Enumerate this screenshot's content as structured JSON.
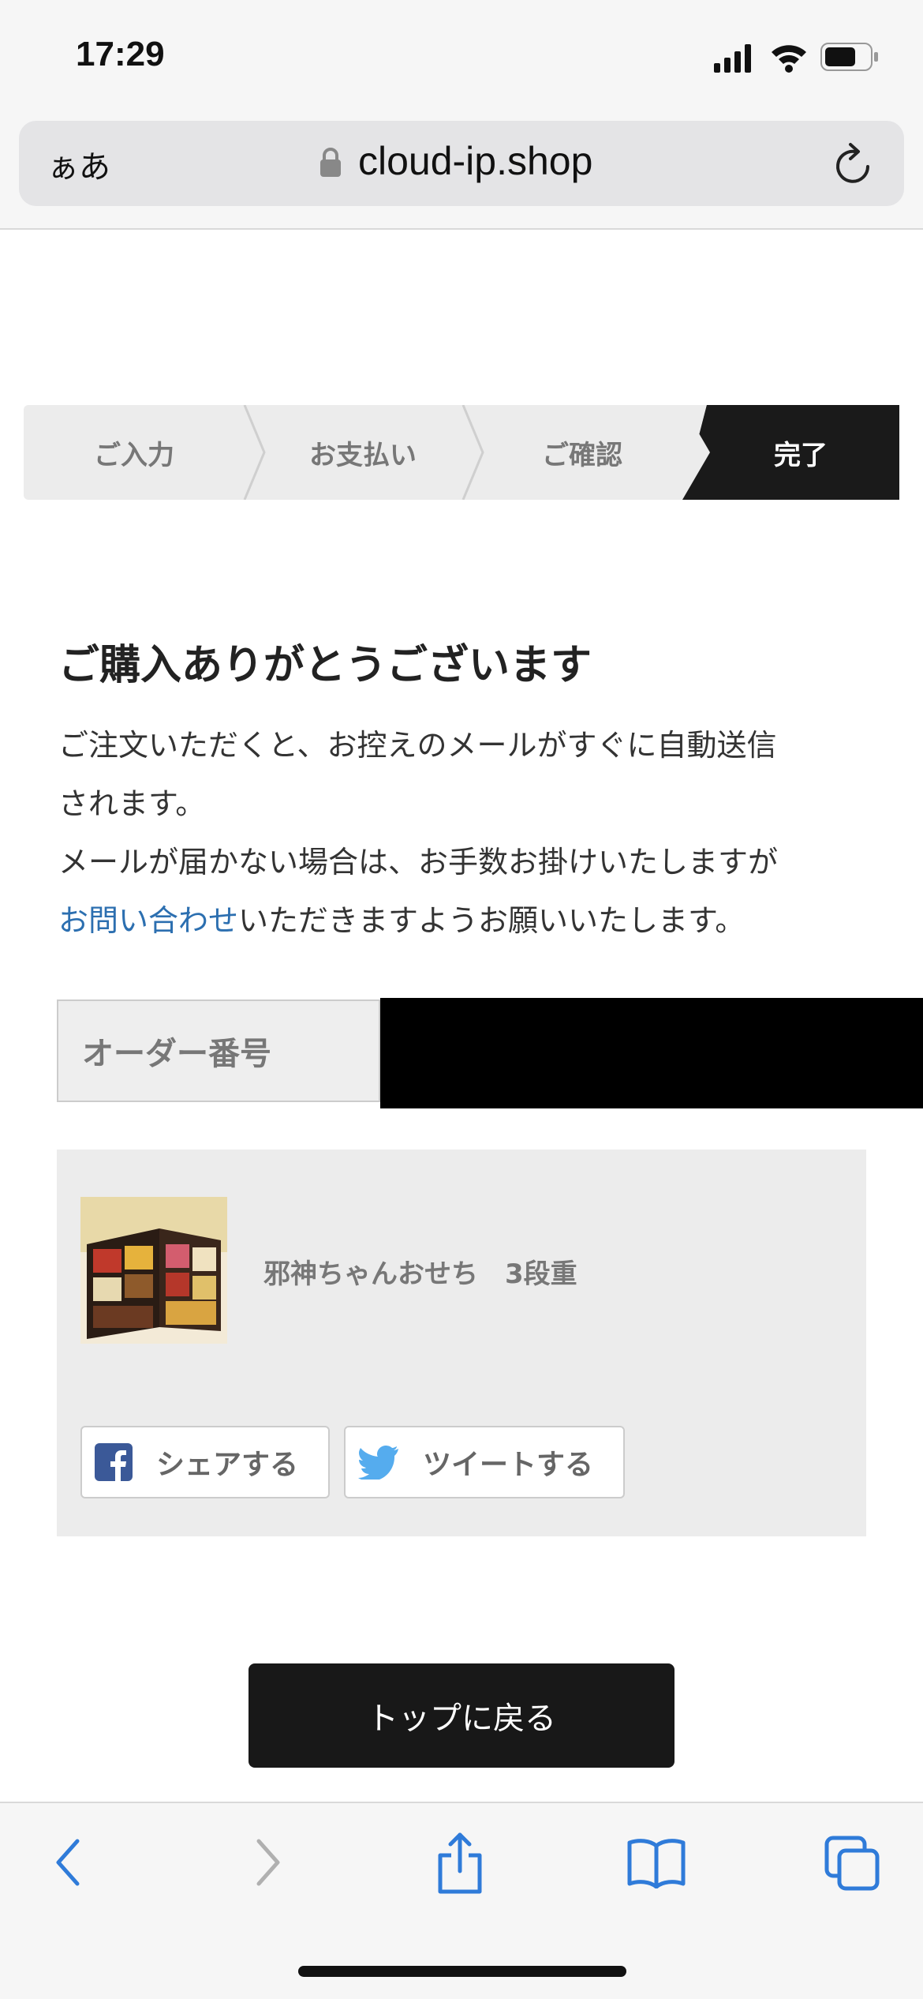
{
  "status": {
    "time": "17:29"
  },
  "browser": {
    "text_size_label": "ぁあ",
    "url": "cloud-ip.shop"
  },
  "steps": [
    {
      "label": "ご入力"
    },
    {
      "label": "お支払い"
    },
    {
      "label": "ご確認"
    },
    {
      "label": "完了",
      "active": true
    }
  ],
  "main": {
    "heading": "ご購入ありがとうございます",
    "line1": "ご注文いただくと、お控えのメールがすぐに自動送信",
    "line2": "されます。",
    "line3": "メールが届かない場合は、お手数お掛けいたしますが",
    "link_text": "お問い合わせ",
    "line4_rest": "いただきますようお願いいたします。",
    "order_label": "オーダー番号",
    "product_name": "邪神ちゃんおせち　3段重",
    "share_facebook": "シェアする",
    "share_twitter": "ツイートする",
    "back_button": "トップに戻る"
  },
  "colors": {
    "accent_link": "#2c6fb0",
    "active_step": "#1a1a1a",
    "ios_blue": "#2f7bd9"
  },
  "icons": [
    "signal-icon",
    "wifi-icon",
    "battery-icon",
    "lock-icon",
    "reload-icon",
    "facebook-icon",
    "twitter-icon",
    "back-icon",
    "forward-icon",
    "share-icon",
    "bookmarks-icon",
    "tabs-icon"
  ]
}
